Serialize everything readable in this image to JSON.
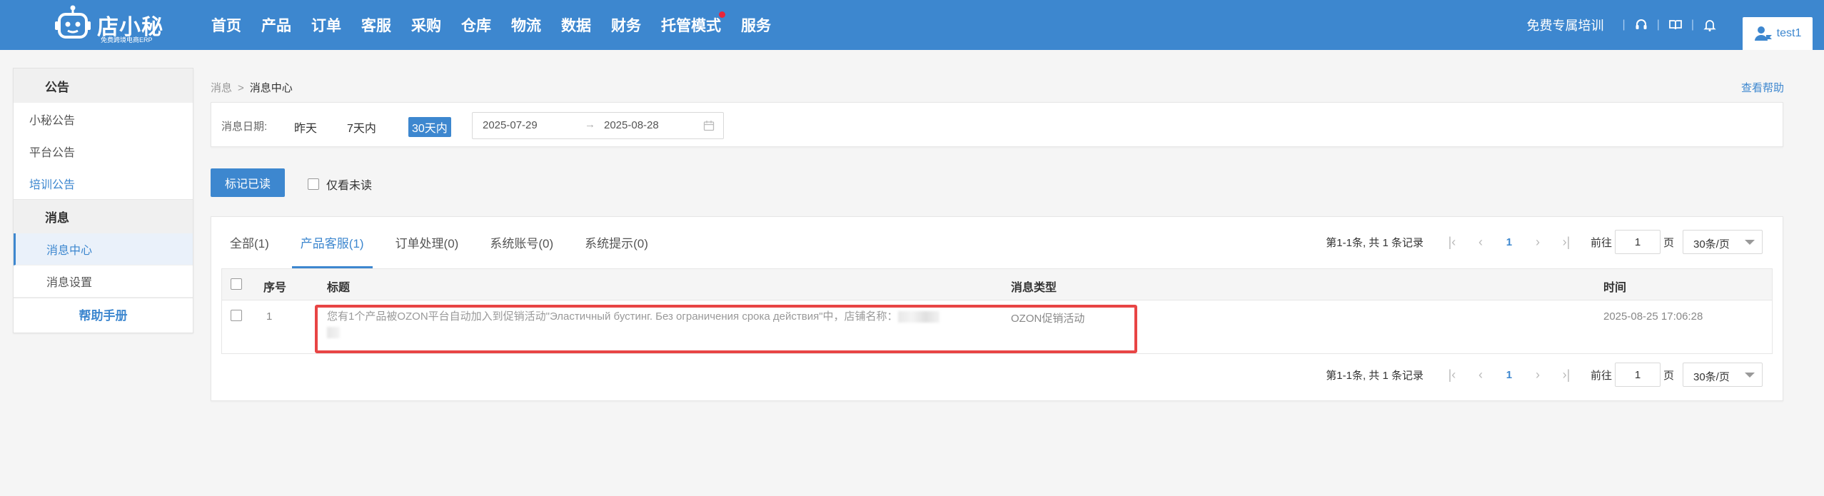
{
  "header": {
    "brand": "店小秘",
    "slogan": "免费跨境电商ERP",
    "nav": [
      {
        "label": "首页"
      },
      {
        "label": "产品"
      },
      {
        "label": "订单"
      },
      {
        "label": "客服"
      },
      {
        "label": "采购"
      },
      {
        "label": "仓库"
      },
      {
        "label": "物流"
      },
      {
        "label": "数据"
      },
      {
        "label": "财务"
      },
      {
        "label": "托管模式",
        "dot": true
      },
      {
        "label": "服务"
      }
    ],
    "training": "免费专属培训",
    "separator": "|",
    "icons": [
      "headset-icon",
      "book-icon",
      "bell-icon"
    ],
    "user": "test1"
  },
  "sidebar": {
    "announce_title": "公告",
    "announce_items": [
      "小秘公告",
      "平台公告",
      "培训公告"
    ],
    "message_title": "消息",
    "message_items": [
      "消息中心",
      "消息设置"
    ],
    "help": "帮助手册"
  },
  "breadcrumb": {
    "parent": "消息",
    "sep": ">",
    "current": "消息中心"
  },
  "help_link": "查看帮助",
  "filter": {
    "label": "消息日期:",
    "options": [
      "昨天",
      "7天内",
      "30天内"
    ],
    "selected": "30天内",
    "start_date": "2025-07-29",
    "arrow": "→",
    "end_date": "2025-08-28"
  },
  "actions": {
    "mark_read": "标记已读",
    "only_unread": "仅看未读"
  },
  "tabs": [
    "全部(1)",
    "产品客服(1)",
    "订单处理(0)",
    "系统账号(0)",
    "系统提示(0)"
  ],
  "active_tab": "产品客服(1)",
  "pagination": {
    "info": "第1-1条, 共 1 条记录",
    "current_page": "1",
    "goto_label": "前往",
    "page_input": "1",
    "page_unit": "页",
    "page_size": "30条/页"
  },
  "table": {
    "headers": {
      "no": "序号",
      "title": "标题",
      "type": "消息类型",
      "time": "时间"
    },
    "rows": [
      {
        "no": "1",
        "title": "您有1个产品被OZON平台自动加入到促销活动\"Эластичный бустинг. Без ограничения срока действия\"中，店铺名称：",
        "type": "OZON促销活动",
        "time": "2025-08-25 17:06:28"
      }
    ]
  },
  "colors": {
    "brand_blue": "#3d87cf",
    "highlight_red": "#e84545",
    "nav_dot": "#e8253b"
  }
}
